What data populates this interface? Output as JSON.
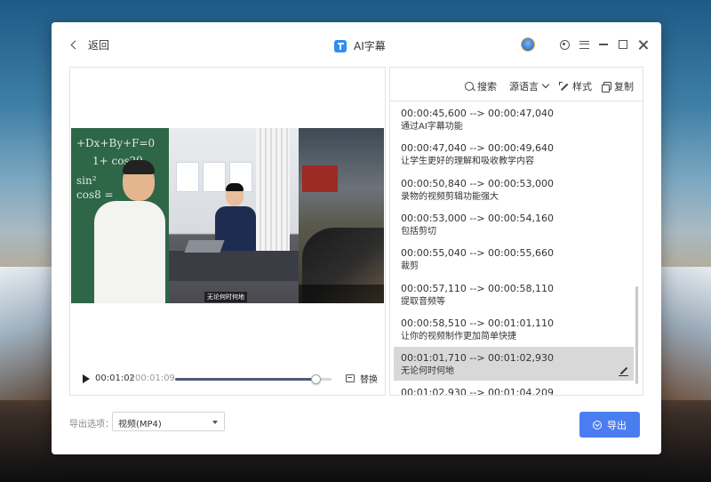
{
  "app": {
    "title": "AI字幕",
    "back_label": "返回"
  },
  "window_controls": {
    "icons": [
      "avatar-icon",
      "settings-gear-icon",
      "menu-icon",
      "minimize-icon",
      "maximize-icon",
      "close-icon"
    ]
  },
  "player": {
    "current_time": "00:01:02",
    "separator": "/",
    "total_time": "00:01:09",
    "progress": 0.9,
    "replace_label": "替换",
    "video_caption": "无论何时何地",
    "board_formulas": [
      "+Dx+By+F=0",
      "1+ cos2θ",
      "sin²",
      "cos8 ="
    ]
  },
  "toolbar": {
    "search_label": "搜索",
    "source_language_label": "源语言",
    "style_label": "样式",
    "copy_label": "复制"
  },
  "subtitles": [
    {
      "time": "00:00:45,600 --> 00:00:47,040",
      "text": "通过AI字幕功能",
      "active": false
    },
    {
      "time": "00:00:47,040 --> 00:00:49,640",
      "text": "让学生更好的理解和吸收教学内容",
      "active": false
    },
    {
      "time": "00:00:50,840 --> 00:00:53,000",
      "text": "录物的视频剪辑功能强大",
      "active": false
    },
    {
      "time": "00:00:53,000 --> 00:00:54,160",
      "text": "包括剪切",
      "active": false
    },
    {
      "time": "00:00:55,040 --> 00:00:55,660",
      "text": "裁剪",
      "active": false
    },
    {
      "time": "00:00:57,110 --> 00:00:58,110",
      "text": "提取音频等",
      "active": false
    },
    {
      "time": "00:00:58,510 --> 00:01:01,110",
      "text": "让你的视频制作更加简单快捷",
      "active": false
    },
    {
      "time": "00:01:01,710 --> 00:01:02,930",
      "text": "无论何时何地",
      "active": true
    },
    {
      "time": "00:01:02,930 --> 00:01:04,209",
      "text": "",
      "active": false
    }
  ],
  "export": {
    "label": "导出选项：",
    "format_value": "视频(MP4)",
    "button_label": "导出"
  },
  "colors": {
    "accent": "#4a7df0",
    "active_row": "#d8d8d8",
    "progress_fill": "#4b5b7a"
  }
}
